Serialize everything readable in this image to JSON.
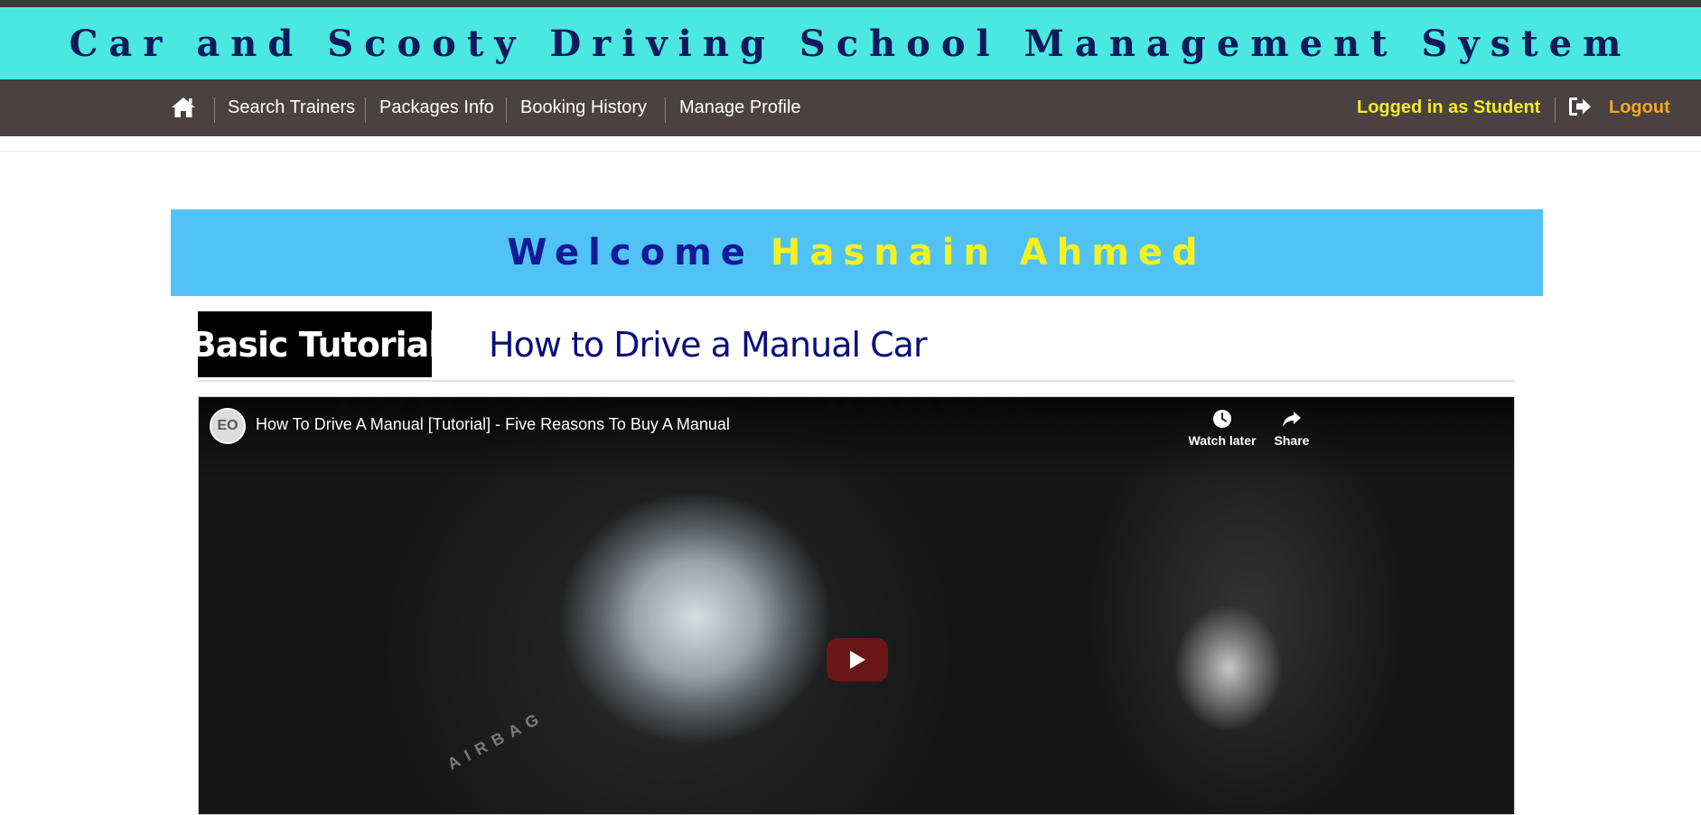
{
  "app": {
    "title": "Car and Scooty Driving School Management System"
  },
  "nav": {
    "home_icon": "home-icon",
    "items": [
      {
        "label": "Search Trainers"
      },
      {
        "label": "Packages Info"
      },
      {
        "label": "Booking History"
      },
      {
        "label": "Manage Profile"
      }
    ],
    "logged_in_text": "Logged in as Student",
    "logout_icon": "sign-out-icon",
    "logout_label": "Logout"
  },
  "welcome": {
    "label": "Welcome",
    "name": "Hasnain Ahmed"
  },
  "tutorial": {
    "badge": "Basic Tutorial",
    "title": "How to Drive a Manual Car"
  },
  "video": {
    "title": "How To Drive A Manual [Tutorial] - Five Reasons To Buy A Manual",
    "watch_later": "Watch later",
    "share": "Share",
    "play_icon": "play-icon"
  },
  "colors": {
    "title_bar": "#4ae8e0",
    "navbar": "#4a4141",
    "welcome_bg": "#51c2f5",
    "welcome_label": "#121a96",
    "welcome_name": "#f5f11e",
    "logged_in": "#f4ea26",
    "logout": "#f4a822"
  }
}
